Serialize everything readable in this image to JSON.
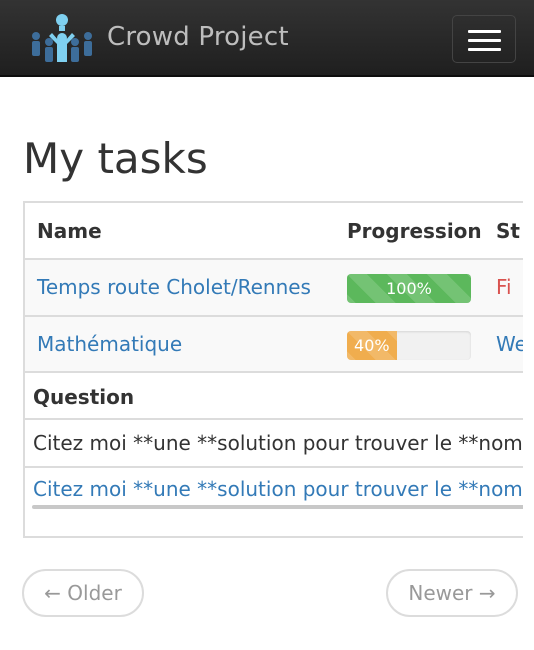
{
  "navbar": {
    "brand": "Crowd Project",
    "logo_icon": "crowd-logo-icon",
    "menu_icon": "hamburger-menu-icon",
    "background": "#222222",
    "brand_color": "#bdbdbd"
  },
  "page": {
    "title": "My tasks"
  },
  "tasks_table": {
    "headers": {
      "name": "Name",
      "progression": "Progression",
      "status": "St"
    },
    "rows": [
      {
        "name": "Temps route Cholet/Rennes",
        "progress_label": "100%",
        "progress_value": 100,
        "progress_color": "#5cb85c",
        "status": "Fi",
        "status_color": "#d9534f"
      },
      {
        "name": "Mathématique",
        "progress_label": "40%",
        "progress_value": 40,
        "progress_color": "#f0ad4e",
        "status": "We",
        "status_color": "#337ab7"
      }
    ]
  },
  "questions_table": {
    "header": "Question",
    "rows": [
      "Citez moi **une **solution pour trouver le **nombre",
      "Citez moi **une **solution pour trouver le **nombre"
    ]
  },
  "pager": {
    "older": "← Older",
    "newer": "Newer →"
  },
  "colors": {
    "link": "#337ab7",
    "border": "#dcdcdc"
  }
}
